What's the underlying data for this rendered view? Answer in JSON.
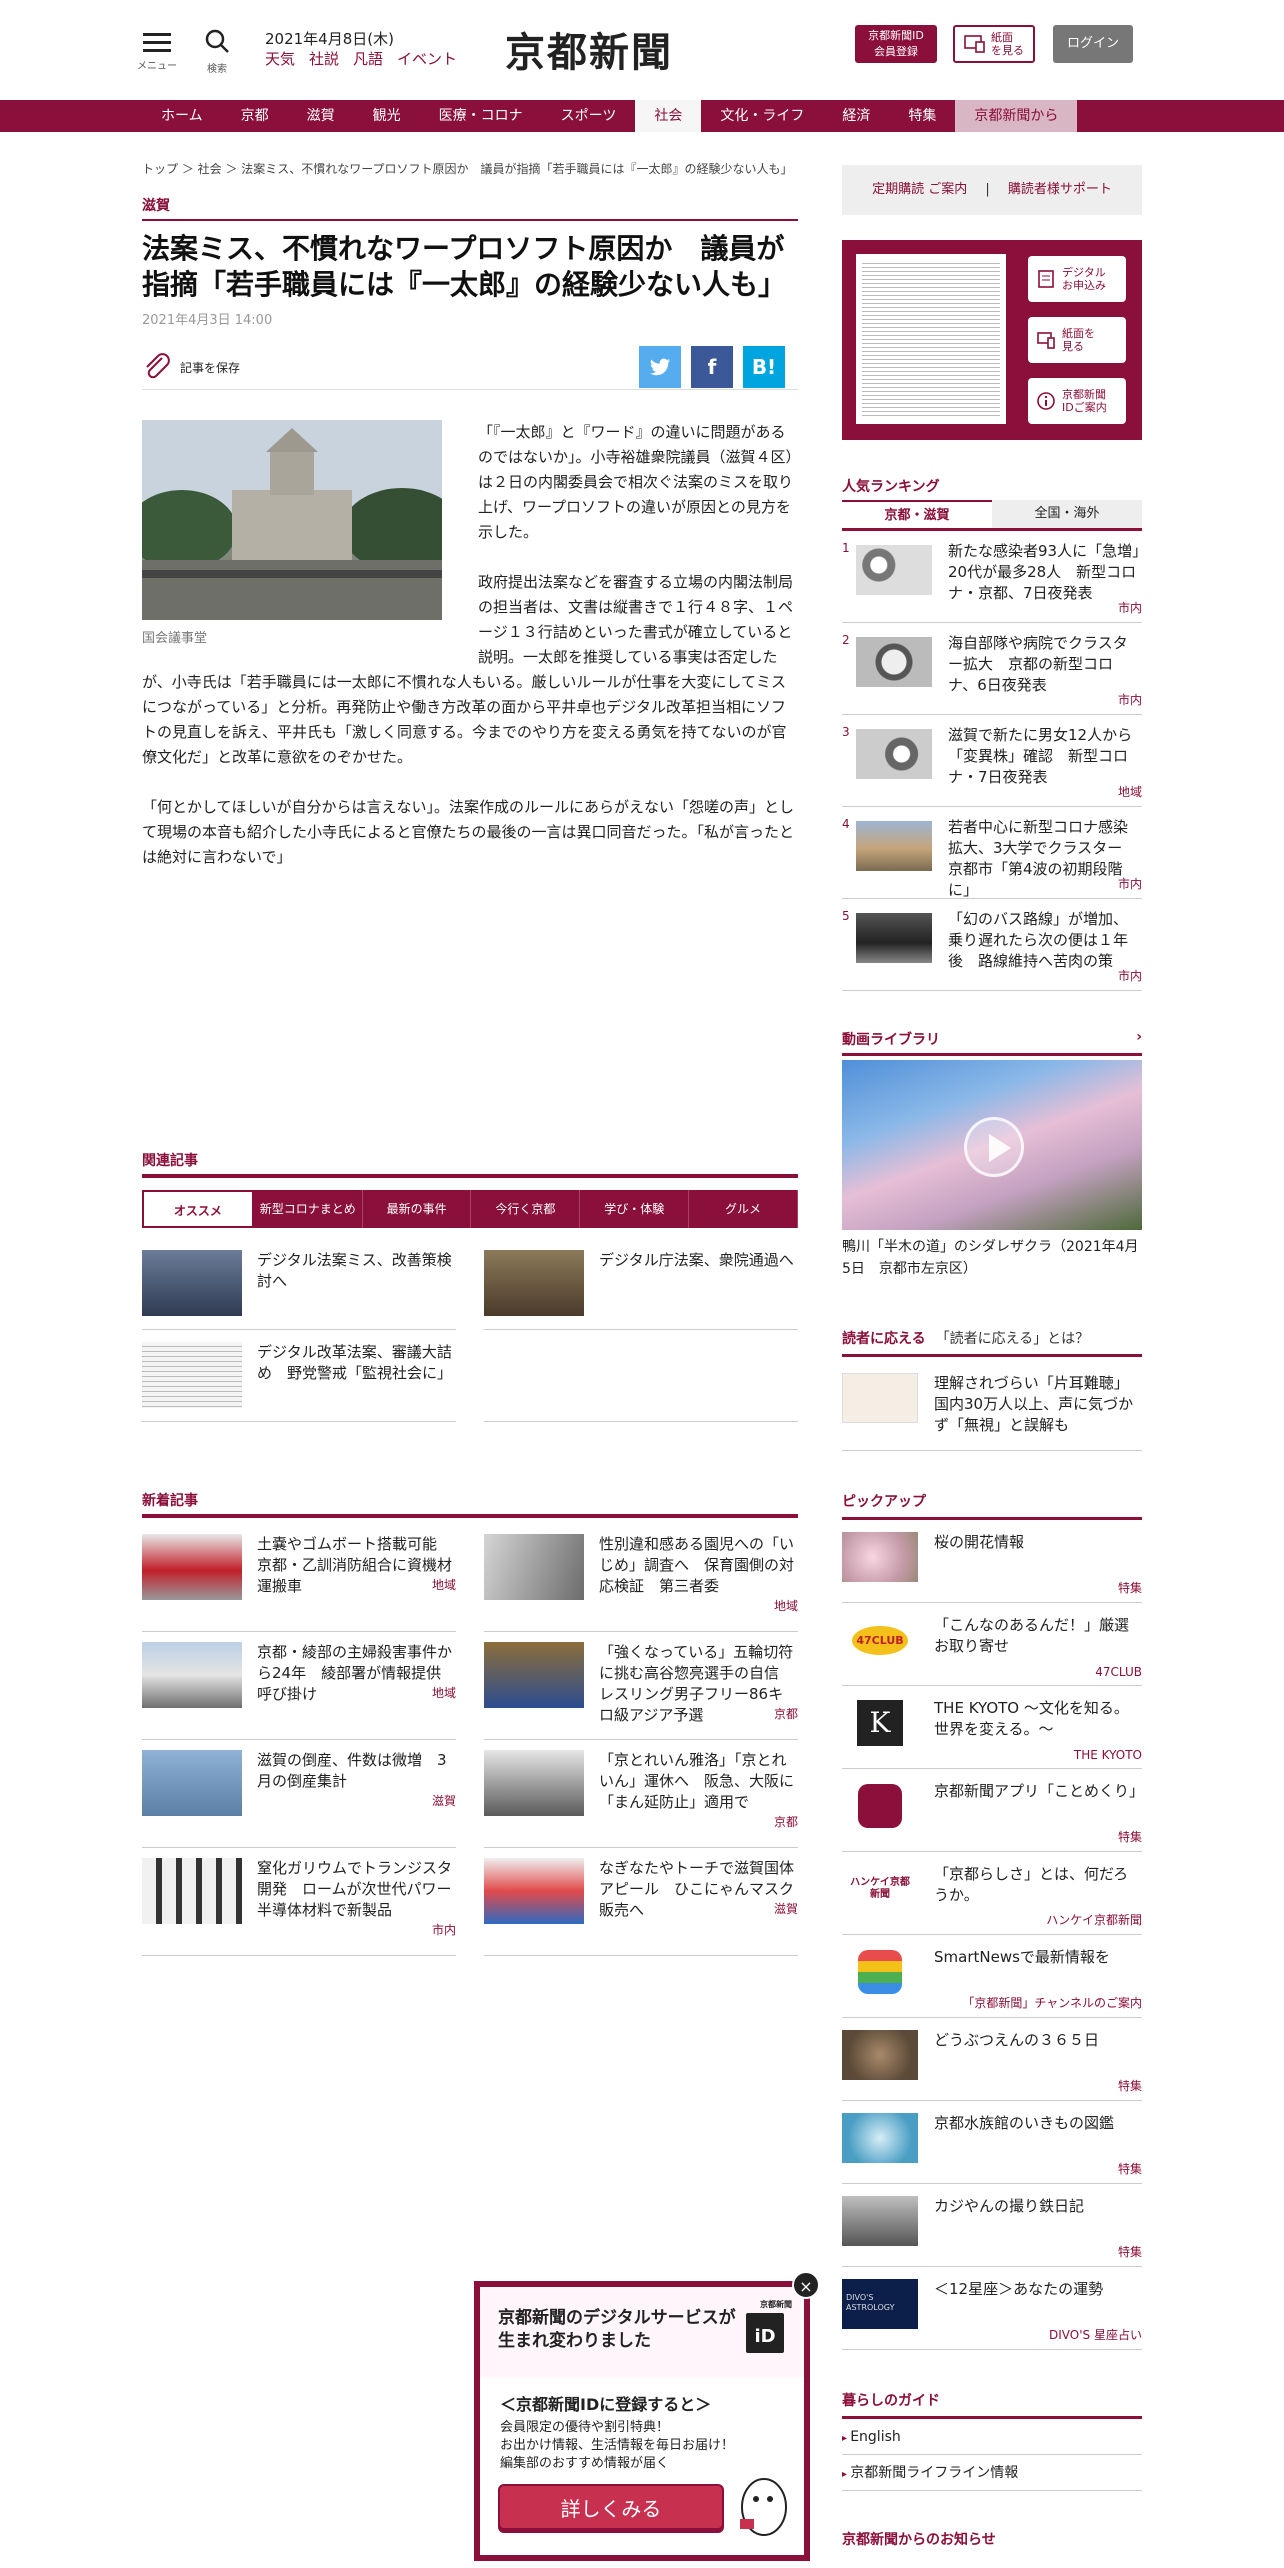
{
  "header": {
    "menu_label": "メニュー",
    "search_label": "検索",
    "date": "2021年4月8日(木)",
    "quick_links": [
      "天気",
      "社説",
      "凡語",
      "イベント"
    ],
    "logo": "京都新聞",
    "register_btn_1": "京都新聞ID",
    "register_btn_2": "会員登録",
    "paper_btn_1": "紙面",
    "paper_btn_2": "を見る",
    "login_btn": "ログイン"
  },
  "nav": [
    "ホーム",
    "京都",
    "滋賀",
    "観光",
    "医療・コロナ",
    "スポーツ",
    "社会",
    "文化・ライフ",
    "経済",
    "特集",
    "京都新聞から"
  ],
  "article": {
    "breadcrumb": "トップ ＞ 社会 ＞ 法案ミス、不慣れなワープロソフト原因か　議員が指摘「若手職員には『一太郎』の経験少ない人も」",
    "category": "滋賀",
    "title": "法案ミス、不慣れなワープロソフト原因か　議員が指摘「若手職員には『一太郎』の経験少ない人も」",
    "date": "2021年4月3日 14:00",
    "save_label": "記事を保存",
    "caption": "国会議事堂",
    "paragraphs": [
      "「『一太郎』と『ワード』の違いに問題があるのではないか」。小寺裕雄衆院議員（滋賀４区）は２日の内閣委員会で相次ぐ法案のミスを取り上げ、ワープロソフトの違いが原因との見方を示した。",
      "政府提出法案などを審査する立場の内閣法制局の担当者は、文書は縦書きで１行４８字、１ページ１３行詰めといった書式が確立していると説明。一太郎を推奨している事実は否定したが、小寺氏は「若手職員には一太郎に不慣れな人もいる。厳しいルールが仕事を大変にしてミスにつながっている」と分析。再発防止や働き方改革の面から平井卓也デジタル改革担当相にソフトの見直しを訴え、平井氏も「激しく同意する。今までのやり方を変える勇気を持てないのが官僚文化だ」と改革に意欲をのぞかせた。",
      "「何とかしてほしいが自分からは言えない」。法案作成のルールにあらがえない「怨嗟の声」として現場の本音も紹介した小寺氏によると官僚たちの最後の一言は異口同音だった。「私が言ったとは絶対に言わないで」"
    ]
  },
  "related": {
    "heading": "関連記事",
    "tabs": [
      "オススメ",
      "新型コロナまとめ",
      "最新の事件",
      "今行く京都",
      "学び・体験",
      "グルメ"
    ],
    "items": [
      "デジタル法案ミス、改善策検討へ",
      "デジタル庁法案、衆院通過へ",
      "デジタル改革法案、審議大詰め　野党警戒「監視社会に」"
    ]
  },
  "news": {
    "heading": "新着記事",
    "items": [
      {
        "title": "土嚢やゴムボート搭載可能　京都・乙訓消防組合に資機材運搬車",
        "tag": "地域"
      },
      {
        "title": "性別違和感ある園児への「いじめ」調査へ　保育園側の対応検証　第三者委",
        "tag": "地域"
      },
      {
        "title": "京都・綾部の主婦殺害事件から24年　綾部署が情報提供呼び掛け",
        "tag": "地域"
      },
      {
        "title": "「強くなっている」五輪切符に挑む高谷惣亮選手の自信　レスリング男子フリー86キロ級アジア予選",
        "tag": "京都"
      },
      {
        "title": "滋賀の倒産、件数は微増　3月の倒産集計",
        "tag": "滋賀"
      },
      {
        "title": "「京とれいん雅洛」「京とれいん」運休へ　阪急、大阪に「まん延防止」適用で",
        "tag": "京都"
      },
      {
        "title": "窒化ガリウムでトランジスタ開発　ロームが次世代パワー半導体材料で新製品",
        "tag": "市内"
      },
      {
        "title": "なぎなたやトーチで滋賀国体アピール　ひこにゃんマスク販売へ",
        "tag": "滋賀"
      }
    ]
  },
  "sidebar": {
    "subscribe": "定期購読 ご案内",
    "support": "購読者様サポート",
    "paper_buttons": [
      "デジタル\nお申込み",
      "紙面を\n見る",
      "京都新聞\nIDご案内"
    ],
    "ranking_heading": "人気ランキング",
    "ranking_tabs": [
      "京都・滋賀",
      "全国・海外"
    ],
    "ranking": [
      {
        "n": "1",
        "title": "新たな感染者93人に「急増」20代が最多28人　新型コロナ・京都、7日夜発表",
        "tag": "市内"
      },
      {
        "n": "2",
        "title": "海自部隊や病院でクラスター拡大　京都の新型コロナ、6日夜発表",
        "tag": "市内"
      },
      {
        "n": "3",
        "title": "滋賀で新たに男女12人から「変異株」確認　新型コロナ・7日夜発表",
        "tag": "地域"
      },
      {
        "n": "4",
        "title": "若者中心に新型コロナ感染拡大、3大学でクラスター　京都市「第4波の初期段階に」",
        "tag": "市内"
      },
      {
        "n": "5",
        "title": "「幻のバス路線」が増加、乗り遅れたら次の便は１年後　路線維持へ苦肉の策",
        "tag": "市内"
      }
    ],
    "video_heading": "動画ライブラリ",
    "video_caption": "鴨川「半木の道」のシダレザクラ（2021年4月5日　京都市左京区）",
    "reader_heading": "読者に応える",
    "reader_q": "「読者に応える」とは？",
    "reader_item": "理解されづらい「片耳難聴」　国内30万人以上、声に気づかず「無視」と誤解も",
    "pickup_heading": "ピックアップ",
    "pickup": [
      {
        "title": "桜の開花情報",
        "tag": "特集"
      },
      {
        "title": "「こんなのあるんだ！」厳選お取り寄せ",
        "tag": "47CLUB"
      },
      {
        "title": "THE KYOTO ～文化を知る。世界を変える。～",
        "tag": "THE KYOTO"
      },
      {
        "title": "京都新聞アプリ「ことめくり」",
        "tag": "特集"
      },
      {
        "title": "「京都らしさ」とは、何だろうか。",
        "tag": "ハンケイ京都新聞"
      },
      {
        "title": "SmartNewsで最新情報を",
        "tag": "「京都新聞」チャンネルのご案内"
      },
      {
        "title": "どうぶつえんの３６５日",
        "tag": "特集"
      },
      {
        "title": "京都水族館のいきもの図鑑",
        "tag": "特集"
      },
      {
        "title": "カジやんの撮り鉄日記",
        "tag": "特集"
      },
      {
        "title": "＜12星座＞あなたの運勢",
        "tag": "DIVO'S 星座占い"
      }
    ],
    "thumb_labels": {
      "club47": "47CLUB",
      "kyoto_k": "K",
      "hankei": "ハンケイ京都新聞",
      "divos": "DIVO'S ASTROLOGY"
    },
    "guide_heading": "暮らしのガイド",
    "guide": [
      "English",
      "京都新聞ライフライン情報"
    ],
    "notice_heading": "京都新聞からのお知らせ"
  },
  "popup": {
    "title": "京都新聞のデジタルサービスが生まれ変わりました",
    "id_logo_small": "京都新聞",
    "id_logo": "iD",
    "subtitle": "＜京都新聞IDに登録すると＞",
    "desc": [
      "会員限定の優待や割引特典！",
      "お出かけ情報、生活情報を毎日お届け！",
      "編集部のおすすめ情報が届く"
    ],
    "cta": "詳しくみる",
    "close": "×"
  },
  "colors": {
    "brand": "#8a0f3a",
    "twitter": "#55acee",
    "facebook": "#3b5998",
    "hatena": "#00a4de"
  }
}
